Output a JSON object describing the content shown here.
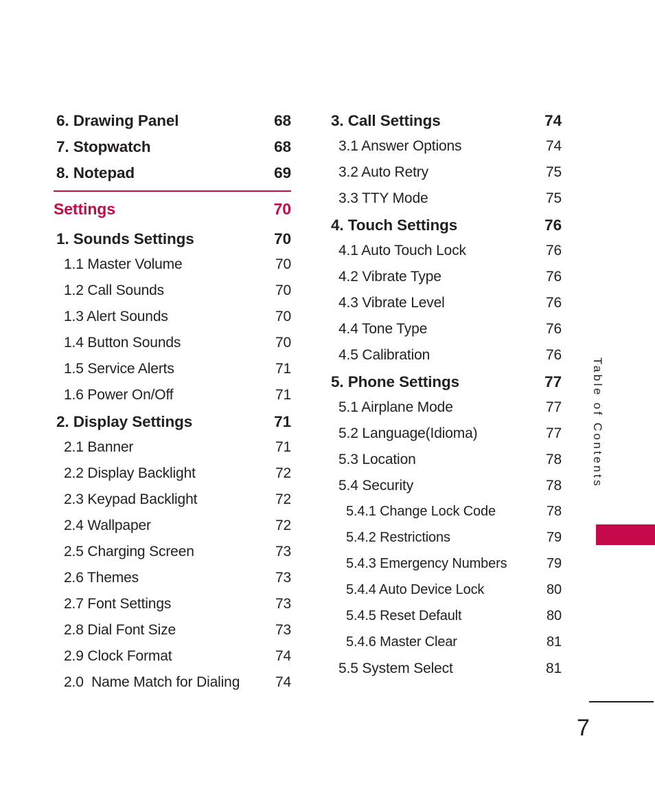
{
  "page": {
    "folio": "7",
    "accent_color": "#c50a4b",
    "text_color": "#231f20"
  },
  "side_tab": {
    "label": "Table of Contents"
  },
  "columns": [
    {
      "name": "left",
      "entries": [
        {
          "level": 1,
          "label": "6. Drawing Panel",
          "page": "68"
        },
        {
          "level": 1,
          "label": "7. Stopwatch",
          "page": "68"
        },
        {
          "level": 1,
          "label": "8. Notepad",
          "page": "69"
        },
        {
          "level": 0,
          "label": "Settings",
          "page": "70",
          "section": true
        },
        {
          "level": 1,
          "label": "1. Sounds Settings",
          "page": "70"
        },
        {
          "level": 2,
          "label": "1.1 Master Volume",
          "page": "70"
        },
        {
          "level": 2,
          "label": "1.2 Call Sounds",
          "page": "70"
        },
        {
          "level": 2,
          "label": "1.3 Alert Sounds",
          "page": "70"
        },
        {
          "level": 2,
          "label": "1.4 Button Sounds",
          "page": "70"
        },
        {
          "level": 2,
          "label": "1.5 Service Alerts",
          "page": "71"
        },
        {
          "level": 2,
          "label": "1.6 Power On/Off",
          "page": "71"
        },
        {
          "level": 1,
          "label": "2. Display Settings",
          "page": "71"
        },
        {
          "level": 2,
          "label": "2.1 Banner",
          "page": "71"
        },
        {
          "level": 2,
          "label": "2.2 Display Backlight",
          "page": "72"
        },
        {
          "level": 2,
          "label": "2.3 Keypad Backlight",
          "page": "72"
        },
        {
          "level": 2,
          "label": "2.4 Wallpaper",
          "page": "72"
        },
        {
          "level": 2,
          "label": "2.5 Charging Screen",
          "page": "73"
        },
        {
          "level": 2,
          "label": "2.6 Themes",
          "page": "73"
        },
        {
          "level": 2,
          "label": "2.7 Font Settings",
          "page": "73"
        },
        {
          "level": 2,
          "label": "2.8 Dial Font Size",
          "page": "73"
        },
        {
          "level": 2,
          "label": "2.9 Clock Format",
          "page": "74"
        },
        {
          "level": 2,
          "label": "2.0  Name Match for Dialing",
          "page": "74"
        }
      ]
    },
    {
      "name": "right",
      "entries": [
        {
          "level": 1,
          "label": "3. Call Settings",
          "page": "74"
        },
        {
          "level": 2,
          "label": "3.1 Answer Options",
          "page": "74"
        },
        {
          "level": 2,
          "label": "3.2 Auto Retry",
          "page": "75"
        },
        {
          "level": 2,
          "label": "3.3 TTY Mode",
          "page": "75"
        },
        {
          "level": 1,
          "label": "4. Touch Settings",
          "page": "76"
        },
        {
          "level": 2,
          "label": "4.1 Auto Touch Lock",
          "page": "76"
        },
        {
          "level": 2,
          "label": "4.2 Vibrate Type",
          "page": "76"
        },
        {
          "level": 2,
          "label": "4.3 Vibrate Level",
          "page": "76"
        },
        {
          "level": 2,
          "label": "4.4 Tone Type",
          "page": "76"
        },
        {
          "level": 2,
          "label": "4.5 Calibration",
          "page": "76"
        },
        {
          "level": 1,
          "label": "5. Phone Settings",
          "page": "77"
        },
        {
          "level": 2,
          "label": "5.1 Airplane Mode",
          "page": "77"
        },
        {
          "level": 2,
          "label": "5.2 Language(Idioma)",
          "page": "77"
        },
        {
          "level": 2,
          "label": "5.3 Location",
          "page": "78"
        },
        {
          "level": 2,
          "label": "5.4 Security",
          "page": "78"
        },
        {
          "level": 3,
          "label": "5.4.1 Change Lock Code",
          "page": "78"
        },
        {
          "level": 3,
          "label": "5.4.2 Restrictions",
          "page": "79"
        },
        {
          "level": 3,
          "label": "5.4.3 Emergency Numbers",
          "page": "79"
        },
        {
          "level": 3,
          "label": "5.4.4 Auto Device Lock",
          "page": "80"
        },
        {
          "level": 3,
          "label": "5.4.5 Reset Default",
          "page": "80"
        },
        {
          "level": 3,
          "label": "5.4.6 Master Clear",
          "page": "81"
        },
        {
          "level": 2,
          "label": "5.5 System Select",
          "page": "81"
        }
      ]
    }
  ]
}
